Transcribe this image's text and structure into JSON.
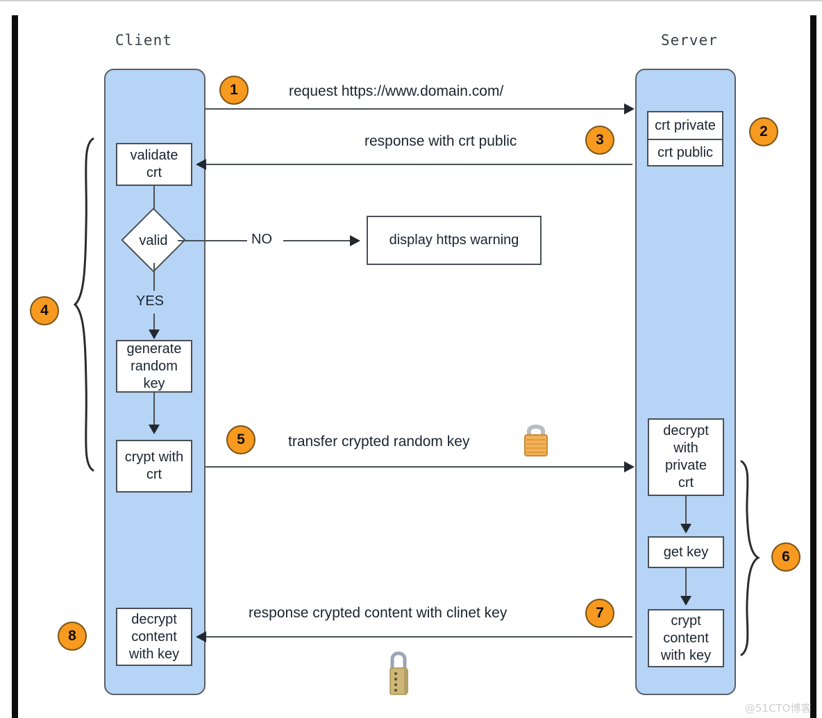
{
  "diagram": {
    "title_client": "Client",
    "title_server": "Server",
    "watermark": "@51CTO博客"
  },
  "colors": {
    "lane_fill": "#b6d4f5",
    "lane_stroke": "#5a5f66",
    "badge_fill": "#f79a1f",
    "badge_stroke": "#7a5418",
    "box_fill": "#ffffff",
    "box_stroke": "#4a4f56",
    "line": "#4a4f56",
    "edge_bar": "#0d0d0d",
    "text": "#1b2430"
  },
  "client_nodes": {
    "validate_crt": "validate\ncrt",
    "valid": "valid",
    "yes": "YES",
    "no": "NO",
    "generate_random_key": "generate\nrandom\nkey",
    "crypt_with_crt": "crypt with\ncrt",
    "decrypt_content_with_key": "decrypt\ncontent\nwith key"
  },
  "client_nodes_lines": {
    "validate_crt": [
      "validate",
      "crt"
    ],
    "generate_random_key": [
      "generate",
      "random",
      "key"
    ],
    "crypt_with_crt": [
      "crypt with",
      "crt"
    ],
    "decrypt_content_with_key": [
      "decrypt",
      "content",
      "with key"
    ]
  },
  "server_nodes": {
    "crt_private": "crt private",
    "crt_public": "crt public",
    "decrypt_with_private_crt": [
      "decrypt",
      "with",
      "private",
      "crt"
    ],
    "get_key": "get key",
    "crypt_content_with_key": [
      "crypt",
      "content",
      "with key"
    ]
  },
  "external_nodes": {
    "display_https_warning": "display https warning"
  },
  "messages": {
    "m1": "request https://www.domain.com/",
    "m3": "response with crt public",
    "m5": "transfer crypted random key",
    "m7": "response crypted content with clinet key"
  },
  "badges": {
    "b1": "1",
    "b2": "2",
    "b3": "3",
    "b4": "4",
    "b5": "5",
    "b6": "6",
    "b7": "7",
    "b8": "8"
  },
  "icons": {
    "lock_closed_orange": "padlock-icon",
    "lock_combination_brass": "combination-padlock-icon"
  }
}
